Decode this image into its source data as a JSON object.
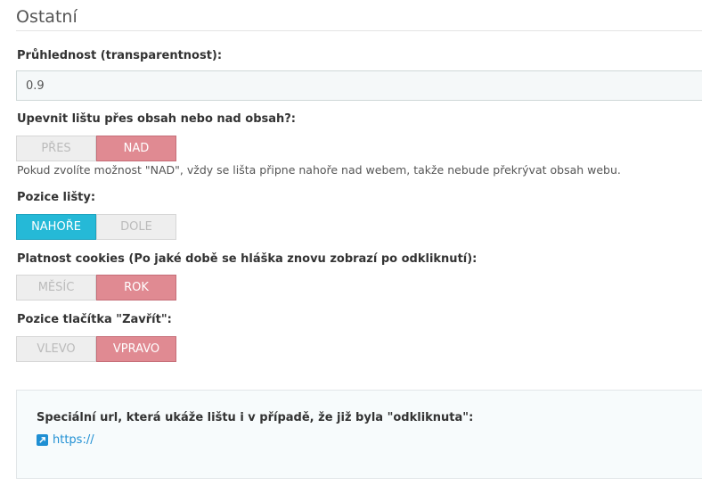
{
  "section": {
    "title": "Ostatní"
  },
  "transparency": {
    "label": "Průhlednost (transparentnost):",
    "value": "0.9"
  },
  "fix_bar": {
    "label": "Upevnit lištu přes obsah nebo nad obsah?:",
    "options": [
      "PŘES",
      "NAD"
    ],
    "selected": "NAD",
    "help": "Pokud zvolíte možnost \"NAD\", vždy se lišta připne nahoře nad webem, takže nebude překrývat obsah webu."
  },
  "bar_position": {
    "label": "Pozice lišty:",
    "options": [
      "NAHOŘE",
      "DOLE"
    ],
    "selected": "NAHOŘE"
  },
  "cookie_validity": {
    "label": "Platnost cookies (Po jaké době se hláška znovu zobrazí po odkliknutí):",
    "options": [
      "MĚSÍC",
      "ROK"
    ],
    "selected": "ROK"
  },
  "close_button_position": {
    "label": "Pozice tlačítka \"Zavřít\":",
    "options": [
      "VLEVO",
      "VPRAVO"
    ],
    "selected": "VPRAVO"
  },
  "special_url": {
    "label": "Speciální url, která ukáže lištu i v případě, že již byla \"odkliknuta\":",
    "link": "https://",
    "icon": "external-link-icon"
  },
  "colors": {
    "active_red": "#e08a92",
    "active_blue": "#25b9d7",
    "link": "#1f8fd3"
  }
}
